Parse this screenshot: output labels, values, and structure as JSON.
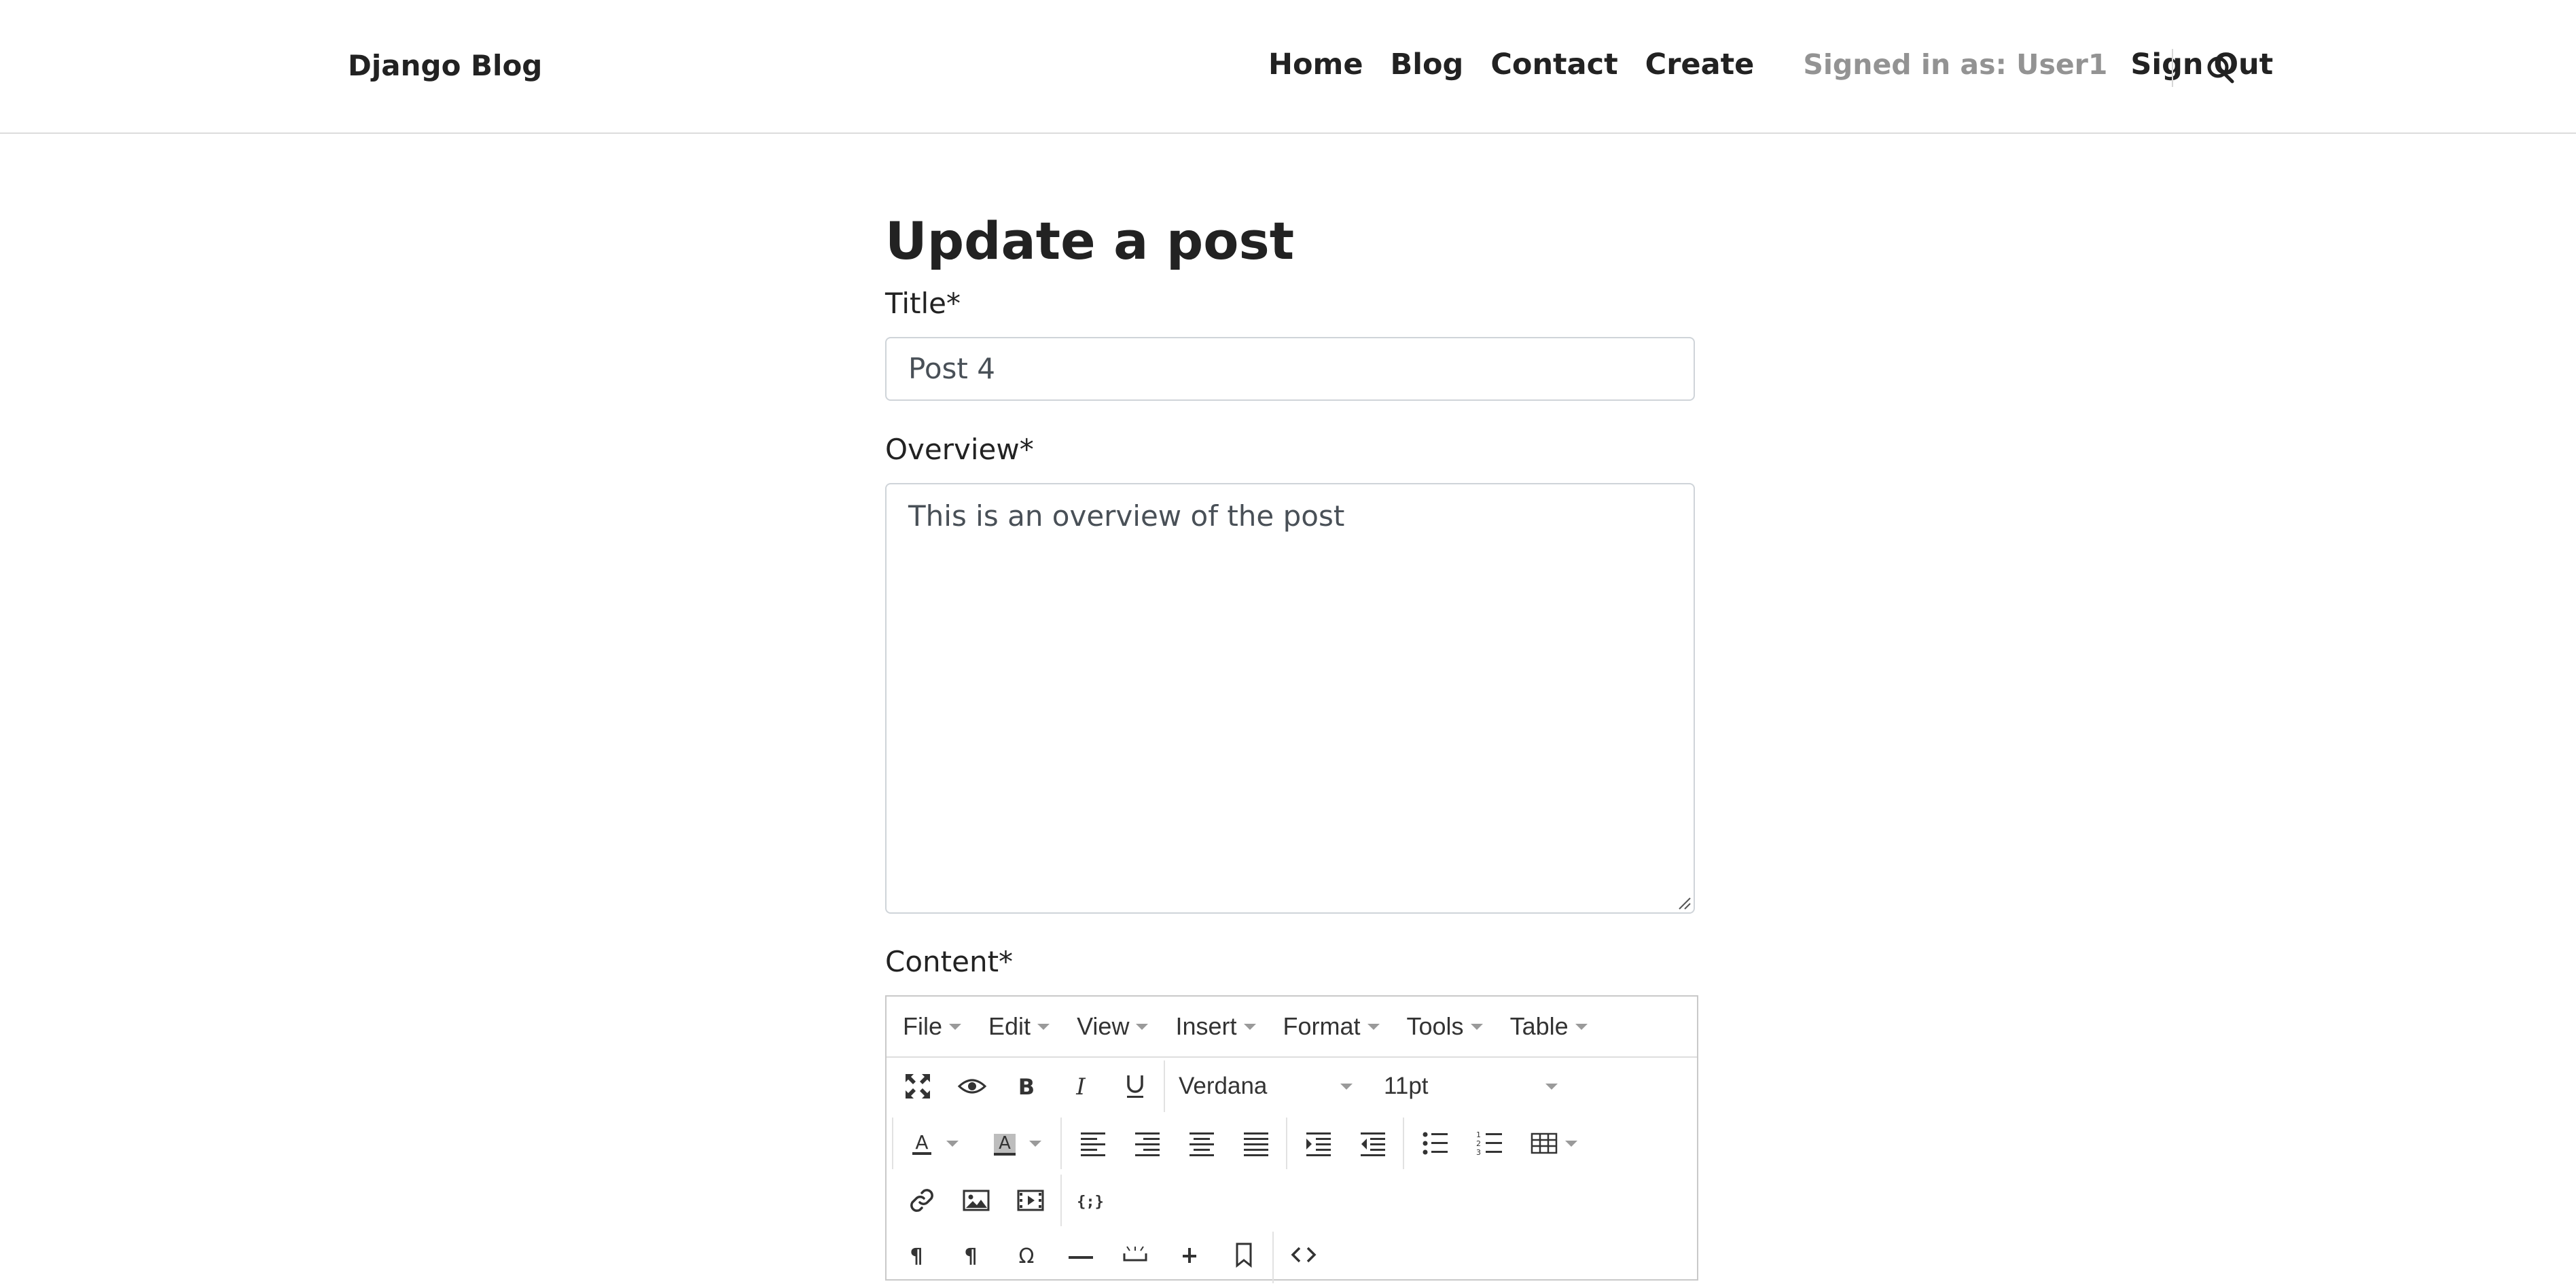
{
  "header": {
    "brand": "Django Blog",
    "nav": [
      "Home",
      "Blog",
      "Contact",
      "Create"
    ],
    "signed_in": "Signed in as: User1",
    "sign_out": "Sign Out",
    "search_icon": "search-icon"
  },
  "form": {
    "page_title": "Update a post",
    "title_label": "Title*",
    "title_value": "Post 4",
    "overview_label": "Overview*",
    "overview_value": "This is an overview of the post",
    "content_label": "Content*"
  },
  "editor": {
    "menus": [
      "File",
      "Edit",
      "View",
      "Insert",
      "Format",
      "Tools",
      "Table"
    ],
    "font_family": "Verdana",
    "font_size": "11pt",
    "toolbar_icons": {
      "row1": [
        "fullscreen-icon",
        "preview-icon",
        "bold-icon",
        "italic-icon",
        "underline-icon"
      ],
      "row2": [
        "text-color-icon",
        "background-color-icon",
        "align-left-icon",
        "align-right-icon",
        "align-center-icon",
        "align-justify-icon",
        "indent-icon",
        "outdent-icon",
        "bullet-list-icon",
        "numbered-list-icon",
        "table-icon"
      ],
      "row3": [
        "link-icon",
        "image-icon",
        "media-icon",
        "code-sample-icon"
      ],
      "row4": [
        "ltr-paragraph-icon",
        "rtl-paragraph-icon",
        "special-char-icon",
        "horizontal-rule-icon",
        "nonbreaking-space-icon",
        "page-break-icon",
        "anchor-icon",
        "source-code-icon"
      ]
    }
  }
}
